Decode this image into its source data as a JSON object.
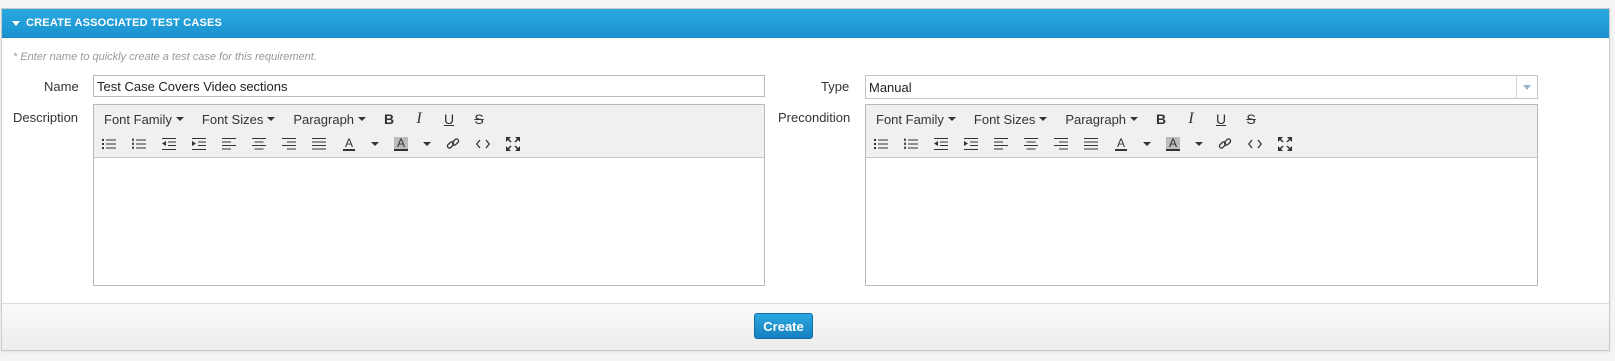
{
  "section": {
    "title": "CREATE ASSOCIATED TEST CASES"
  },
  "hint": "* Enter name to quickly create a test case for this requirement.",
  "fields": {
    "name_label": "Name",
    "name_value": "Test Case Covers Video sections",
    "type_label": "Type",
    "type_value": "Manual",
    "description_label": "Description",
    "precondition_label": "Precondition"
  },
  "toolbar": {
    "font_family": "Font Family",
    "font_sizes": "Font Sizes",
    "paragraph": "Paragraph",
    "bold": "B",
    "italic": "I",
    "underline": "U",
    "strike": "S",
    "text_color": "A",
    "highlight": "A"
  },
  "actions": {
    "create_label": "Create"
  },
  "colors": {
    "header_blue": "#1b93cf",
    "button_blue": "#1680c0"
  }
}
